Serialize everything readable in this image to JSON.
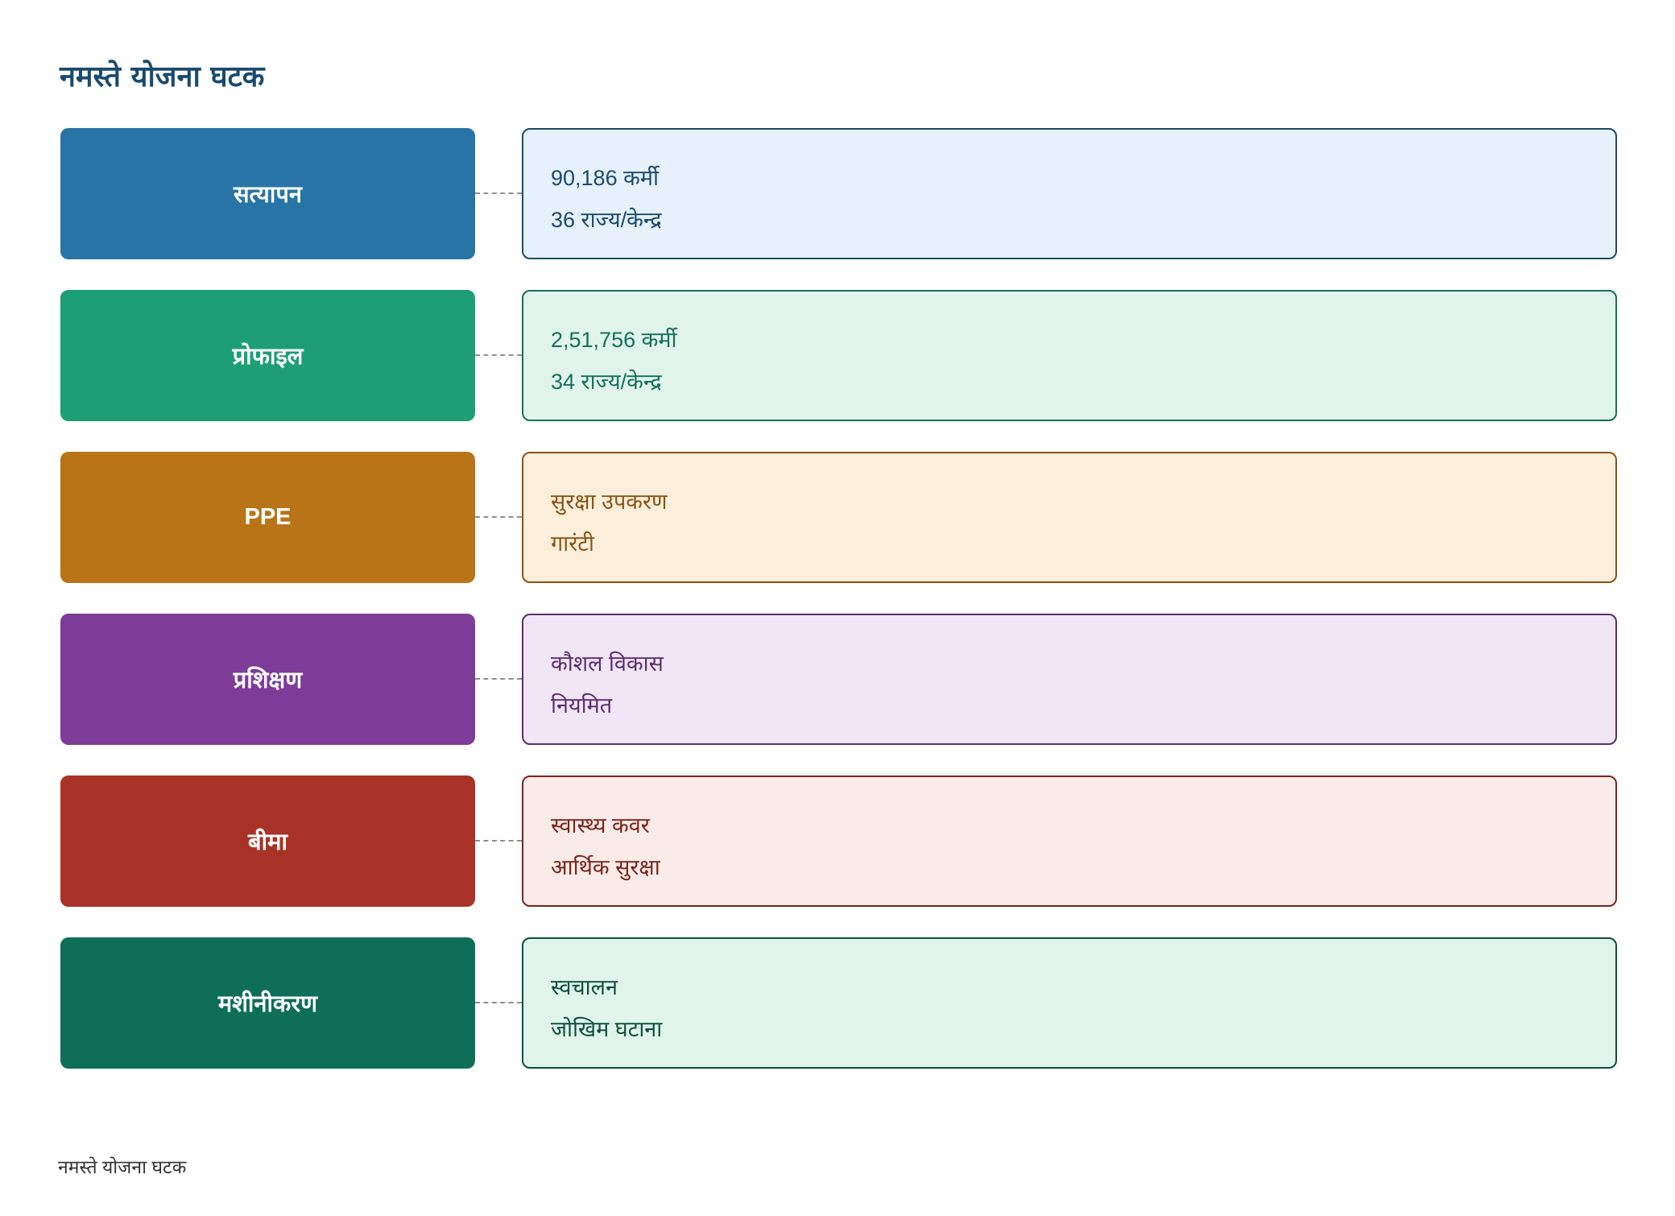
{
  "title": "नमस्ते योजना घटक",
  "footer": "नमस्ते योजना घटक",
  "rows": [
    {
      "label": "सत्यापन",
      "color": "#2874a6",
      "detail_bg": "#e6f1fb",
      "detail_border": "#1a4a6e",
      "detail_text": "#1a4a6e",
      "lines": [
        "90,186 कर्मी",
        "36 राज्य/केन्द्र"
      ]
    },
    {
      "label": "प्रोफाइल",
      "color": "#1e9e74",
      "detail_bg": "#e1f4ec",
      "detail_border": "#15705a",
      "detail_text": "#15705a",
      "lines": [
        "2,51,756 कर्मी",
        "34 राज्य/केन्द्र"
      ]
    },
    {
      "label": "PPE",
      "color": "#b97417",
      "detail_bg": "#fbeedb",
      "detail_border": "#8a5312",
      "detail_text": "#8a5312",
      "lines": [
        "सुरक्षा उपकरण",
        "गारंटी"
      ]
    },
    {
      "label": "प्रशिक्षण",
      "color": "#7d3c98",
      "detail_bg": "#f0e6f6",
      "detail_border": "#5b2c6f",
      "detail_text": "#5b2c6f",
      "lines": [
        "कौशल विकास",
        "नियमित"
      ]
    },
    {
      "label": "बीमा",
      "color": "#a93226",
      "detail_bg": "#f9ebe7",
      "detail_border": "#7b241c",
      "detail_text": "#7b241c",
      "lines": [
        "स्वास्थ्य कवर",
        "आर्थिक सुरक्षा"
      ]
    },
    {
      "label": "मशीनीकरण",
      "color": "#0f6e57",
      "detail_bg": "#e1f4ec",
      "detail_border": "#0b4f3e",
      "detail_text": "#0b4f3e",
      "lines": [
        "स्वचालन",
        "जोखिम घटाना"
      ]
    }
  ]
}
